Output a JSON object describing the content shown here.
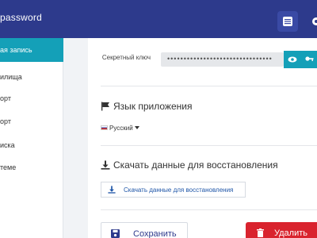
{
  "header": {
    "app_title": "password",
    "list_icon": "list-icon",
    "settings_icon": "gear-icon"
  },
  "sidebar": {
    "items": [
      {
        "label": "ая запись",
        "active": true
      },
      {
        "label": "илища",
        "active": false
      },
      {
        "label": "орт",
        "active": false
      },
      {
        "label": "орт",
        "active": false
      },
      {
        "label": "иска",
        "active": false
      },
      {
        "label": "теме",
        "active": false
      }
    ]
  },
  "secret_key": {
    "label": "Секретный ключ",
    "value": "••••••••••••••••••••••••••••••••",
    "show_icon": "eye-icon",
    "generate_icon": "key-icon"
  },
  "language": {
    "title": "Язык приложения",
    "icon": "flag-icon",
    "selected": "Русский"
  },
  "recovery": {
    "title": "Скачать данные для восстановления",
    "icon": "download-icon",
    "button_label": "Скачать данные для восстановления"
  },
  "actions": {
    "save_label": "Сохранить",
    "save_icon": "save-icon",
    "delete_label": "Удалить",
    "delete_icon": "trash-icon"
  },
  "colors": {
    "header": "#2d3a8c",
    "accent": "#14a0b8",
    "danger": "#d9232e"
  }
}
